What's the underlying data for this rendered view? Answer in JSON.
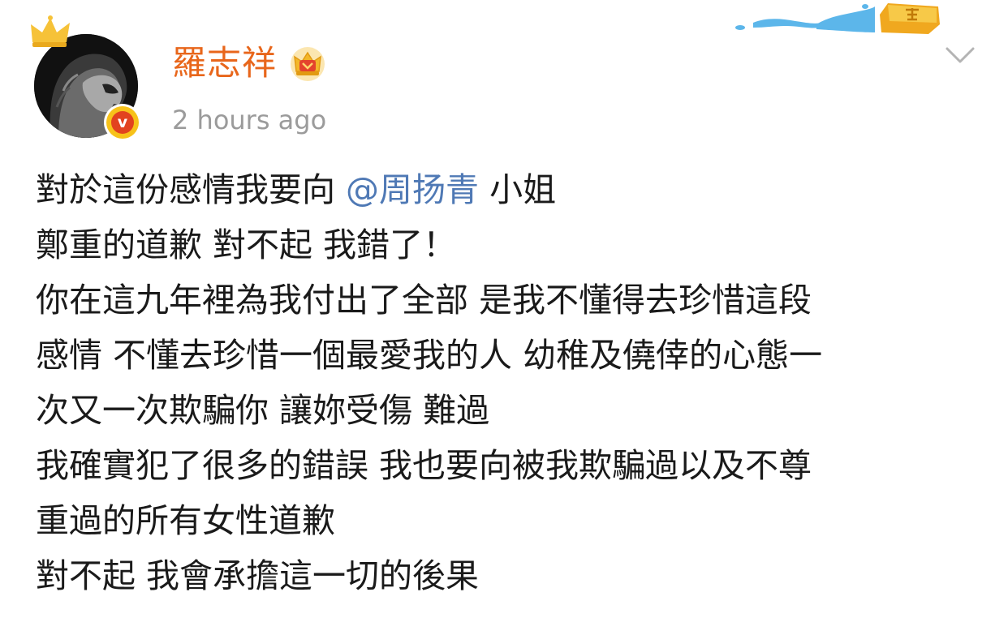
{
  "post": {
    "author": {
      "name": "羅志祥",
      "verified_badge_letter": "v"
    },
    "timestamp": "2 hours ago",
    "body": {
      "line1_before": "對於這份感情我要向 ",
      "line1_mention": "@周扬青",
      "line1_after": " 小姐",
      "lines": [
        "鄭重的道歉 對不起 我錯了！",
        "你在這九年裡為我付出了全部 是我不懂得去珍惜這段",
        "感情 不懂去珍惜一個最愛我的人 幼稚及僥倖的心態一",
        "次又一次欺騙你 讓妳受傷 難過",
        "我確實犯了很多的錯誤 我也要向被我欺騙過以及不尊",
        "重過的所有女性道歉",
        "對不起  我會承擔這一切的後果"
      ]
    }
  },
  "icons": {
    "crown_badge": "crown-icon",
    "vip_badge": "vip-crown-icon",
    "menu": "chevron-down-icon",
    "decoration": "sea-wave-decoration",
    "coin": "coin-icon"
  },
  "colors": {
    "username": "#e8661b",
    "mention": "#4f79b5",
    "timestamp": "#9b9b9b",
    "text": "#1a1a1a",
    "verify_outer": "#f7c21a",
    "verify_inner": "#e2421f"
  }
}
